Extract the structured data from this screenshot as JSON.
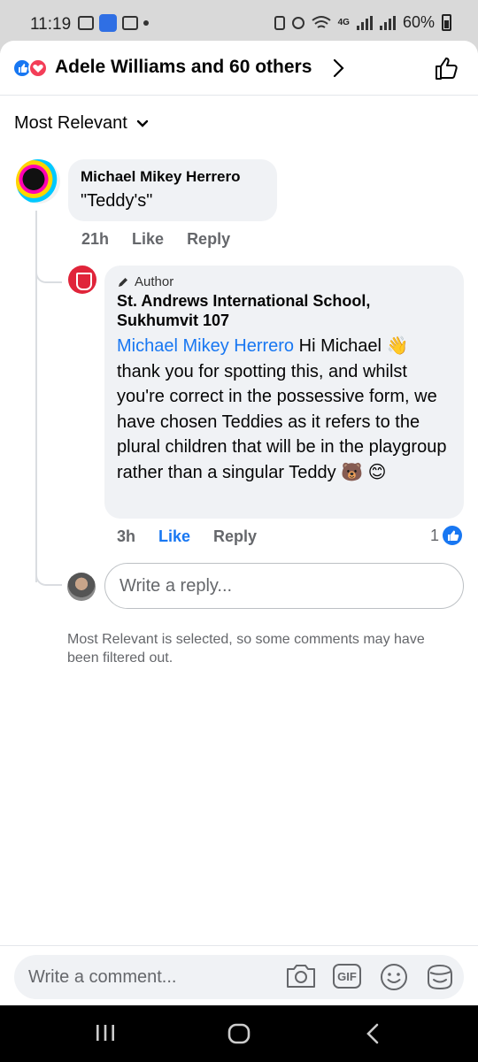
{
  "status_bar": {
    "time": "11:19",
    "network": "4G",
    "battery": "60%"
  },
  "reactions": {
    "summary": "Adele Williams and 60 others",
    "icons": [
      "like-icon",
      "love-icon"
    ]
  },
  "sort": {
    "label": "Most Relevant"
  },
  "comments": [
    {
      "author": "Michael Mikey Herrero",
      "text": "\"Teddy's\"",
      "time": "21h",
      "like_label": "Like",
      "reply_label": "Reply"
    }
  ],
  "reply": {
    "badge": "Author",
    "author": "St. Andrews International School, Sukhumvit 107",
    "mention": "Michael Mikey Herrero",
    "text": " Hi Michael 👋 thank you for spotting this, and whilst you're correct in the possessive form, we have chosen Teddies as it refers to the plural children that will be in the playgroup rather than a singular Teddy 🐻 😊",
    "time": "3h",
    "like_label": "Like",
    "reply_label": "Reply",
    "like_count": "1"
  },
  "reply_input": {
    "placeholder": "Write a reply..."
  },
  "filter_note": "Most Relevant is selected, so some comments may have been filtered out.",
  "composer": {
    "placeholder": "Write a comment...",
    "gif_label": "GIF"
  },
  "colors": {
    "facebook_blue": "#1877f2",
    "love_red": "#f33e58",
    "bubble_gray": "#f0f2f5",
    "secondary_text": "#65676b"
  }
}
